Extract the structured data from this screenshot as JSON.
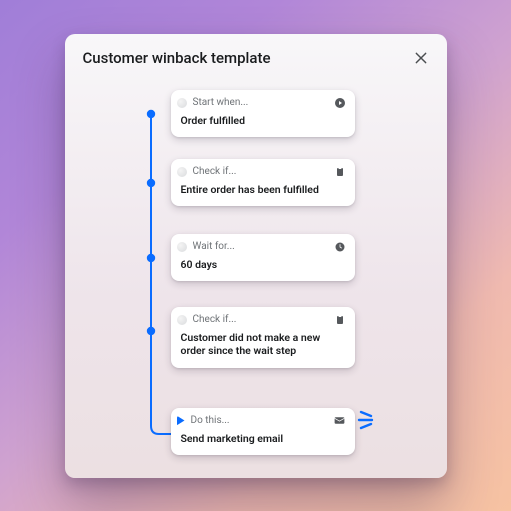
{
  "header": {
    "title": "Customer winback template"
  },
  "steps": [
    {
      "label": "Start when...",
      "text": "Order fulfilled",
      "icon": "play"
    },
    {
      "label": "Check if...",
      "text": "Entire order has been fulfilled",
      "icon": "clipboard"
    },
    {
      "label": "Wait for...",
      "text": "60 days",
      "icon": "clock"
    },
    {
      "label": "Check if...",
      "text": "Customer did not make a new order since the wait step",
      "icon": "clipboard"
    },
    {
      "label": "Do this...",
      "text": "Send marketing email",
      "icon": "mail"
    }
  ],
  "colors": {
    "accent": "#0a6cff",
    "rail": "#0a6cff"
  }
}
